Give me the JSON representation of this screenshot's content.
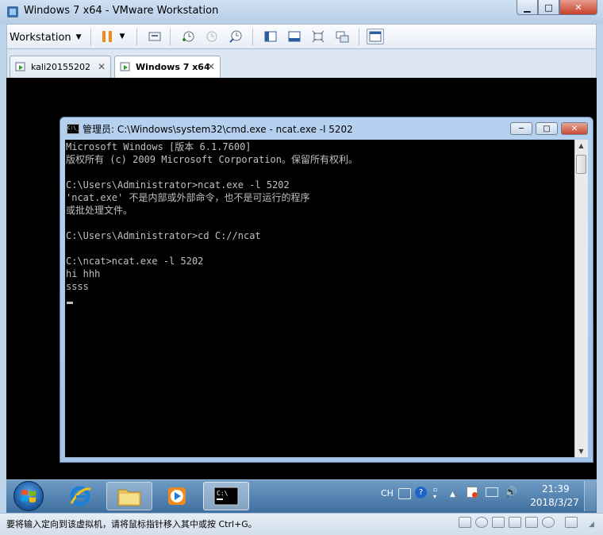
{
  "window": {
    "title": "Windows 7 x64 - VMware Workstation",
    "minimize": "▁",
    "maximize": "□",
    "close": "✕"
  },
  "toolbar": {
    "menu_label": "Workstation",
    "menu_arrow": "▼"
  },
  "tabs": [
    {
      "label": "kali20155202",
      "close": "✕"
    },
    {
      "label": "Windows 7 x64",
      "close": "✕"
    }
  ],
  "cmd": {
    "icon_text": "C:\\_",
    "title": "管理员: C:\\Windows\\system32\\cmd.exe - ncat.exe  -l 5202",
    "minimize": "─",
    "maximize": "□",
    "close": "✕",
    "lines": [
      "Microsoft Windows [版本 6.1.7600]",
      "版权所有 (c) 2009 Microsoft Corporation。保留所有权利。",
      "",
      "C:\\Users\\Administrator>ncat.exe -l 5202",
      "'ncat.exe' 不是内部或外部命令，也不是可运行的程序",
      "或批处理文件。",
      "",
      "C:\\Users\\Administrator>cd C://ncat",
      "",
      "C:\\ncat>ncat.exe -l 5202",
      "hi hhh",
      "ssss"
    ],
    "scroll_up": "▲",
    "scroll_down": "▼"
  },
  "taskbar": {
    "tray_lang": "CH",
    "time": "21:39",
    "date": "2018/3/27"
  },
  "statusbar": {
    "text": "要将输入定向到该虚拟机，请将鼠标指针移入其中或按 Ctrl+G。"
  }
}
